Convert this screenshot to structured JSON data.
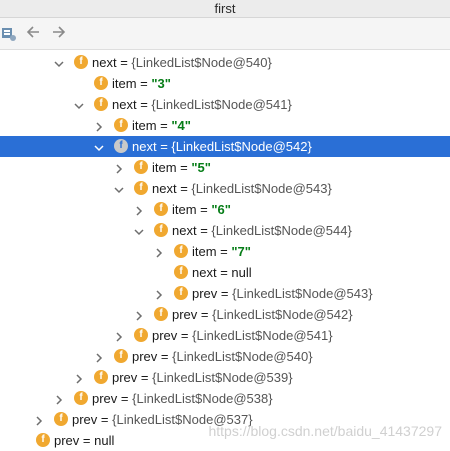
{
  "window": {
    "title": "first"
  },
  "toolbar": {
    "back_icon": "back-arrow-icon",
    "forward_icon": "forward-arrow-icon",
    "debugger_icon": "debugger-icon"
  },
  "tree": {
    "rows": [
      {
        "name": "next",
        "eq": " = ",
        "value": "{LinkedList$Node@540}",
        "kind": "obj",
        "expander": "expanded"
      },
      {
        "name": "item",
        "eq": " = ",
        "value": "\"3\"",
        "kind": "str",
        "expander": "none"
      },
      {
        "name": "next",
        "eq": " = ",
        "value": "{LinkedList$Node@541}",
        "kind": "obj",
        "expander": "expanded"
      },
      {
        "name": "item",
        "eq": " = ",
        "value": "\"4\"",
        "kind": "str",
        "expander": "collapsed"
      },
      {
        "name": "next",
        "eq": " = ",
        "value": "{LinkedList$Node@542}",
        "kind": "obj",
        "expander": "expanded",
        "selected": true
      },
      {
        "name": "item",
        "eq": " = ",
        "value": "\"5\"",
        "kind": "str",
        "expander": "collapsed"
      },
      {
        "name": "next",
        "eq": " = ",
        "value": "{LinkedList$Node@543}",
        "kind": "obj",
        "expander": "expanded"
      },
      {
        "name": "item",
        "eq": " = ",
        "value": "\"6\"",
        "kind": "str",
        "expander": "collapsed"
      },
      {
        "name": "next",
        "eq": " = ",
        "value": "{LinkedList$Node@544}",
        "kind": "obj",
        "expander": "expanded"
      },
      {
        "name": "item",
        "eq": " = ",
        "value": "\"7\"",
        "kind": "str",
        "expander": "collapsed"
      },
      {
        "name": "next",
        "eq": " = ",
        "value": "null",
        "kind": "null",
        "expander": "none"
      },
      {
        "name": "prev",
        "eq": " = ",
        "value": "{LinkedList$Node@543}",
        "kind": "obj",
        "expander": "collapsed"
      },
      {
        "name": "prev",
        "eq": " = ",
        "value": "{LinkedList$Node@542}",
        "kind": "obj",
        "expander": "collapsed"
      },
      {
        "name": "prev",
        "eq": " = ",
        "value": "{LinkedList$Node@541}",
        "kind": "obj",
        "expander": "collapsed"
      },
      {
        "name": "prev",
        "eq": " = ",
        "value": "{LinkedList$Node@540}",
        "kind": "obj",
        "expander": "collapsed"
      },
      {
        "name": "prev",
        "eq": " = ",
        "value": "{LinkedList$Node@539}",
        "kind": "obj",
        "expander": "collapsed"
      },
      {
        "name": "prev",
        "eq": " = ",
        "value": "{LinkedList$Node@538}",
        "kind": "obj",
        "expander": "collapsed"
      },
      {
        "name": "prev",
        "eq": " = ",
        "value": "{LinkedList$Node@537}",
        "kind": "obj",
        "expander": "collapsed"
      },
      {
        "name": "prev",
        "eq": " = ",
        "value": "null",
        "kind": "null",
        "expander": "none"
      }
    ],
    "field_badge": "f"
  },
  "watermark": "https://blog.csdn.net/baidu_41437297",
  "colors": {
    "selection": "#2a6fd6",
    "field_badge": "#f0a830",
    "string_value": "#067d17"
  }
}
